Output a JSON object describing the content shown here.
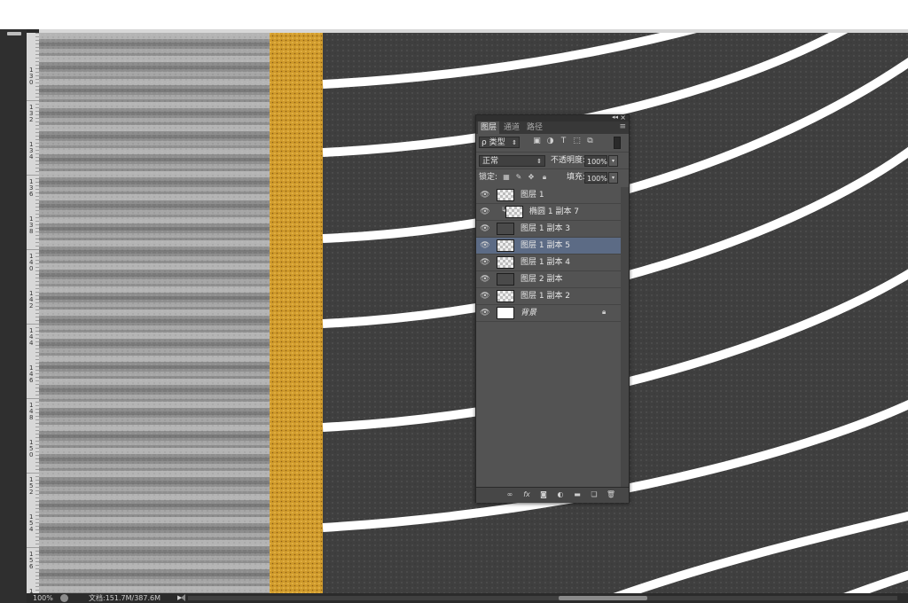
{
  "status_bar": {
    "zoom": "100%",
    "doc_info": "文档:151.7M/387.6M"
  },
  "ruler_v_labels": [
    "130",
    "132",
    "134",
    "136",
    "138",
    "140",
    "142",
    "144",
    "146",
    "148",
    "150",
    "152",
    "154",
    "156",
    "158"
  ],
  "layers_panel": {
    "tabs": [
      {
        "label": "图层",
        "active": true
      },
      {
        "label": "通道",
        "active": false
      },
      {
        "label": "路径",
        "active": false
      }
    ],
    "filter": {
      "label": "ρ 类型"
    },
    "blend_mode": "正常",
    "opacity_label": "不透明度:",
    "opacity_value": "100%",
    "lock_label": "锁定:",
    "fill_label": "填充:",
    "fill_value": "100%",
    "layers": [
      {
        "name": "图层 1",
        "thumb": "checker",
        "clipped": false,
        "selected": false,
        "italic": false,
        "locked": false
      },
      {
        "name": "椭圆 1 副本 7",
        "thumb": "checker",
        "clipped": true,
        "selected": false,
        "italic": false,
        "locked": false
      },
      {
        "name": "图层 1 副本 3",
        "thumb": "dark",
        "clipped": false,
        "selected": false,
        "italic": false,
        "locked": false
      },
      {
        "name": "图层 1 副本 5",
        "thumb": "checker",
        "clipped": false,
        "selected": true,
        "italic": false,
        "locked": false
      },
      {
        "name": "图层 1 副本 4",
        "thumb": "checker",
        "clipped": false,
        "selected": false,
        "italic": false,
        "locked": false
      },
      {
        "name": "图层 2 副本",
        "thumb": "dark",
        "clipped": false,
        "selected": false,
        "italic": false,
        "locked": false
      },
      {
        "name": "图层 1 副本 2",
        "thumb": "checker",
        "clipped": false,
        "selected": false,
        "italic": false,
        "locked": false
      },
      {
        "name": "背景",
        "thumb": "white",
        "clipped": false,
        "selected": false,
        "italic": true,
        "locked": true
      }
    ]
  }
}
